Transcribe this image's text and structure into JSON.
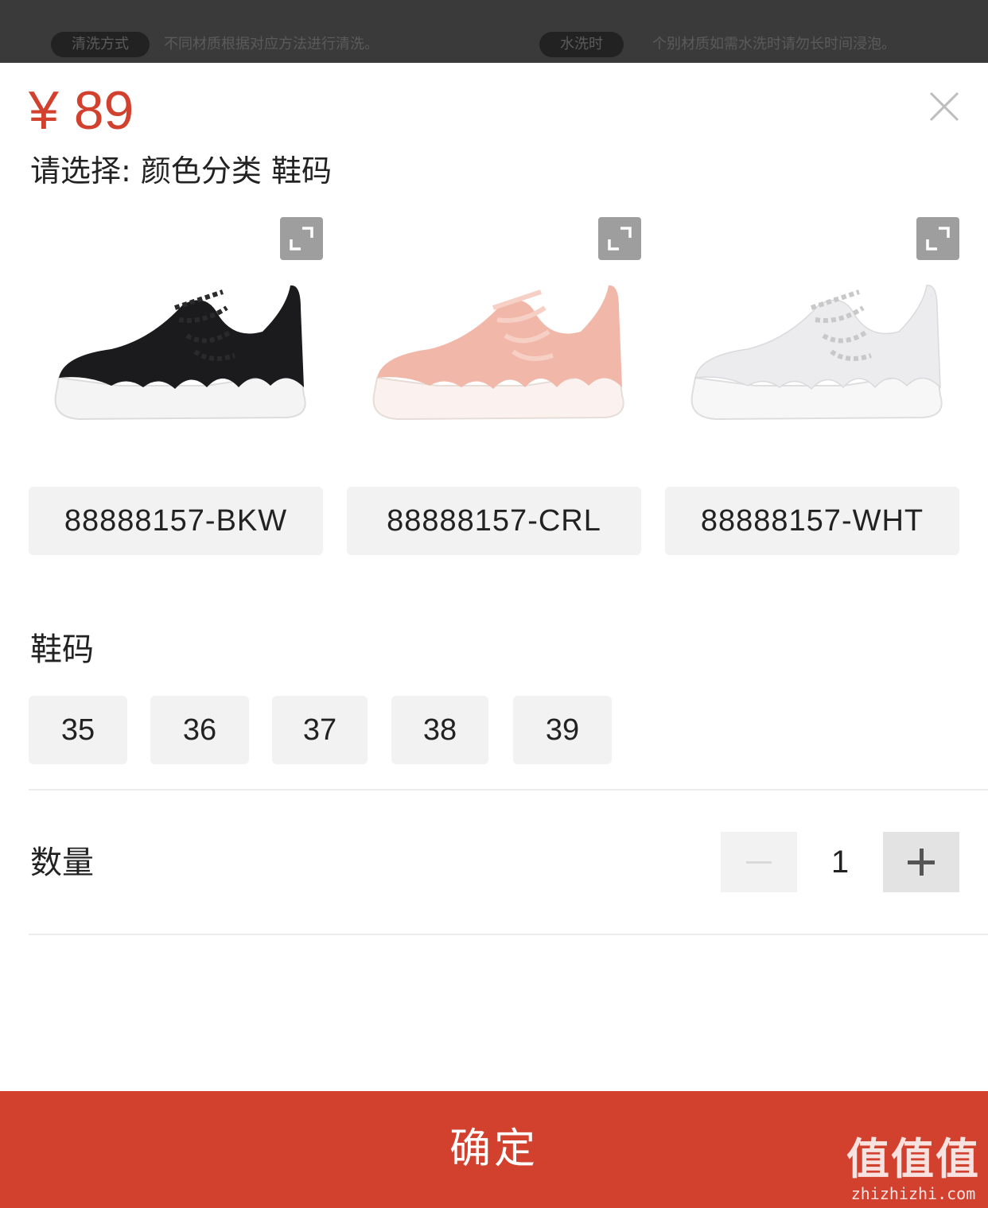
{
  "background": {
    "tags": [
      {
        "tag": "清洗方式",
        "text": "不同材质根据对应方法进行清洗。"
      },
      {
        "tag": "水洗时",
        "text": "个别材质如需水洗时请勿长时间浸泡。"
      }
    ]
  },
  "product": {
    "price": "¥ 89",
    "prompt": "请选择: 颜色分类 鞋码"
  },
  "colors": {
    "items": [
      {
        "code": "88888157-BKW",
        "upper": "#1b1b1d",
        "sole": "#f4f4f4",
        "lace": "#2a2a2a"
      },
      {
        "code": "88888157-CRL",
        "upper": "#f1b7a9",
        "sole": "#fbf1ee",
        "lace": "#f6cfc5"
      },
      {
        "code": "88888157-WHT",
        "upper": "#ececee",
        "sole": "#f7f7f7",
        "lace": "#d8d8d8"
      }
    ]
  },
  "sizes": {
    "title": "鞋码",
    "options": [
      "35",
      "36",
      "37",
      "38",
      "39"
    ]
  },
  "quantity": {
    "label": "数量",
    "value": "1"
  },
  "actions": {
    "confirm_label": "确定"
  },
  "watermark": {
    "brand": "值值值",
    "domain": "zhizhizhi.com"
  },
  "theme": {
    "accent": "#d2402e",
    "button_bg": "#f2f2f2"
  }
}
